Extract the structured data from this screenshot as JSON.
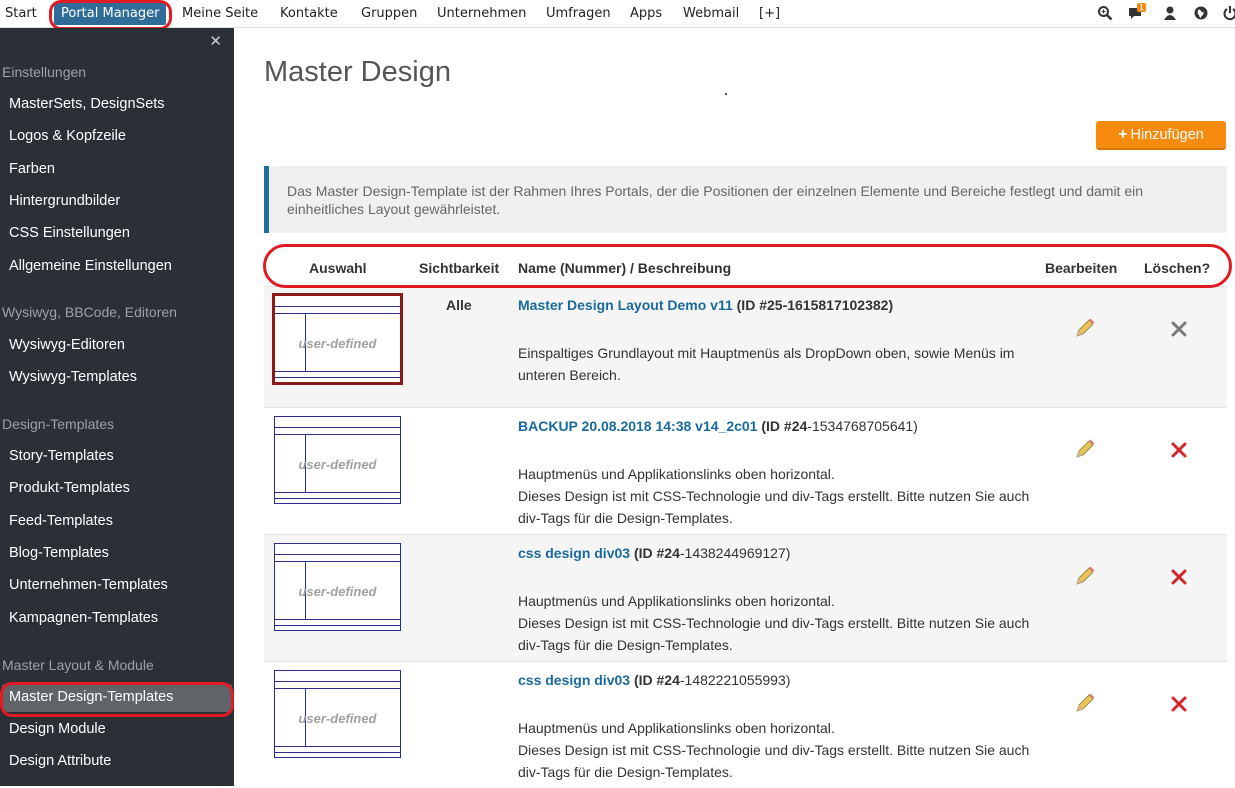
{
  "topnav": {
    "items": [
      "Start",
      "Portal Manager",
      "Meine Seite",
      "Kontakte",
      "Gruppen",
      "Unternehmen",
      "Umfragen",
      "Apps",
      "Webmail",
      "[+]"
    ],
    "notification_count": "1",
    "icons": [
      "search-icon",
      "chat-icon",
      "user-icon",
      "globe-icon",
      "power-icon"
    ]
  },
  "sidebar": {
    "close_label": "✕",
    "groups": [
      {
        "label": "Einstellungen",
        "items": [
          "MasterSets, DesignSets",
          "Logos & Kopfzeile",
          "Farben",
          "Hintergrundbilder",
          "CSS Einstellungen",
          "Allgemeine Einstellungen"
        ]
      },
      {
        "label": "Wysiwyg, BBCode, Editoren",
        "items": [
          "Wysiwyg-Editoren",
          "Wysiwyg-Templates"
        ]
      },
      {
        "label": "Design-Templates",
        "items": [
          "Story-Templates",
          "Produkt-Templates",
          "Feed-Templates",
          "Blog-Templates",
          "Unternehmen-Templates",
          "Kampagnen-Templates"
        ]
      },
      {
        "label": "Master Layout & Module",
        "items": [
          "Master Design-Templates",
          "Design Module",
          "Design Attribute"
        ]
      }
    ],
    "active_item": "Master Design-Templates"
  },
  "main": {
    "title": "Master Design",
    "add_button": "Hinzufügen",
    "info": "Das Master Design-Template ist der Rahmen Ihres Portals, der die Positionen der einzelnen Elemente und Bereiche festlegt und damit ein einheitliches Layout gewährleistet.",
    "columns": [
      "Auswahl",
      "Sichtbarkeit",
      "Name (Nummer) / Beschreibung",
      "Bearbeiten",
      "Löschen?"
    ],
    "thumb_label": "user-defined",
    "rows": [
      {
        "visibility": "Alle",
        "name": "Master Design Layout Demo v11",
        "id_prefix": "(ID #25",
        "id_suffix": "-1615817102382)",
        "desc1": "Einspaltiges Grundlayout mit Hauptmenüs als DropDown oben, sowie Menüs im unteren Bereich.",
        "desc2": "",
        "selected": true
      },
      {
        "visibility": "",
        "name": "BACKUP 20.08.2018 14:38 v14_2c01",
        "id_prefix": "(ID #24",
        "id_suffix": "-1534768705641)",
        "desc1": "Hauptmenüs und Applikationslinks oben horizontal.",
        "desc2": "Dieses Design ist mit CSS-Technologie und div-Tags erstellt. Bitte nutzen Sie auch div-Tags für die Design-Templates.",
        "selected": false
      },
      {
        "visibility": "",
        "name": "css design div03",
        "id_prefix": "(ID #24",
        "id_suffix": "-1438244969127)",
        "desc1": "Hauptmenüs und Applikationslinks oben horizontal.",
        "desc2": "Dieses Design ist mit CSS-Technologie und div-Tags erstellt. Bitte nutzen Sie auch div-Tags für die Design-Templates.",
        "selected": false
      },
      {
        "visibility": "",
        "name": "css design div03",
        "id_prefix": "(ID #24",
        "id_suffix": "-1482221055993)",
        "desc1": "Hauptmenüs und Applikationslinks oben horizontal.",
        "desc2": "Dieses Design ist mit CSS-Technologie und div-Tags erstellt. Bitte nutzen Sie auch div-Tags für die Design-Templates.",
        "selected": false
      }
    ]
  },
  "colors": {
    "accent": "#2f6d98",
    "add_button": "#f68b0e",
    "sidebar_bg": "#2b3036",
    "link": "#1a6a9e",
    "highlight_ring": "#e11b24"
  }
}
